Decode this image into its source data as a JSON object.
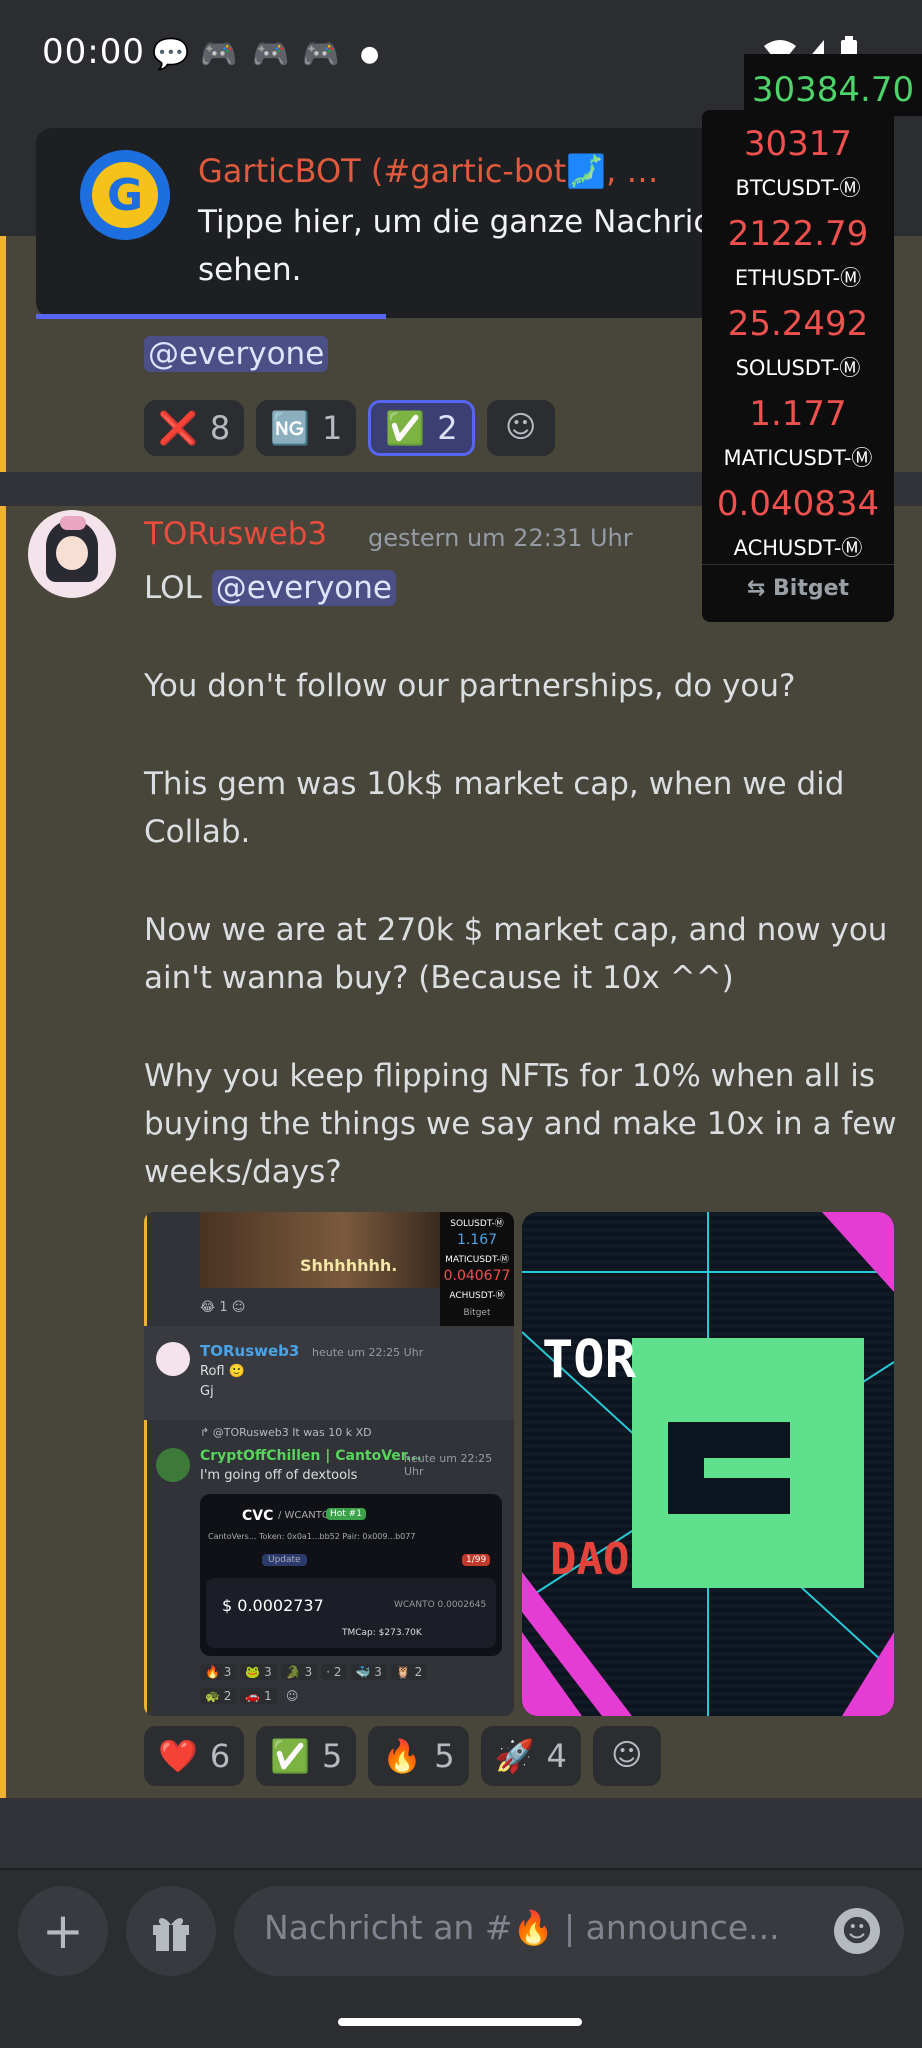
{
  "status_bar": {
    "time": "00:00"
  },
  "notification": {
    "title": "GarticBOT (#gartic-bot🗾, …",
    "text_line1": "Tippe hier, um die ganze Nachricht zu",
    "text_line2": "sehen."
  },
  "previous_message": {
    "mention": "@everyone",
    "reactions": [
      {
        "emoji": "❌",
        "count": "8"
      },
      {
        "emoji": "🆖",
        "count": "1"
      },
      {
        "emoji": "✅",
        "count": "2",
        "active": true
      }
    ]
  },
  "ticker": {
    "top_value": "30384.70",
    "items": [
      {
        "price": "30317",
        "symbol": "BTCUSDT-Ⓜ"
      },
      {
        "price": "2122.79",
        "symbol": "ETHUSDT-Ⓜ"
      },
      {
        "price": "25.2492",
        "symbol": "SOLUSDT-Ⓜ"
      },
      {
        "price": "1.177",
        "symbol": "MATICUSDT-Ⓜ"
      },
      {
        "price": "0.040834",
        "symbol": "ACHUSDT-Ⓜ"
      }
    ],
    "brand": "Bitget"
  },
  "message": {
    "author": "TORusweb3",
    "timestamp": "gestern um 22:31 Uhr",
    "line_lol": "LOL",
    "mention": "@everyone",
    "paragraphs": {
      "p1": "You don't follow our partnerships, do you?",
      "p2a": "This gem was 10k$ market cap, when we did",
      "p2b": "Collab.",
      "p3a": "Now we are at 270k $ market cap, and now you",
      "p3b": "ain't wanna buy? (Because it 10x ^^)",
      "p4a": "Why you keep flipping NFTs for 10% when all is",
      "p4b": "buying the things we say and make 10x in a few",
      "p4c": "weeks/days?"
    },
    "reactions": [
      {
        "emoji": "❤️",
        "count": "6"
      },
      {
        "emoji": "✅",
        "count": "5"
      },
      {
        "emoji": "🔥",
        "count": "5"
      },
      {
        "emoji": "🚀",
        "count": "4"
      }
    ]
  },
  "screenshot_image": {
    "gif_caption": "Shhhhhhh.",
    "mini_ticker": {
      "sym1": "SOLUSDT-Ⓜ",
      "p1": "1.167",
      "sym2": "MATICUSDT-Ⓜ",
      "p2": "0.040677",
      "sym3": "ACHUSDT-Ⓜ",
      "brand": "Bitget"
    },
    "mini_react_count": "1",
    "author1": "TORusweb3",
    "time1": "heute um 22:25 Uhr",
    "line1": "Rofl 🙂",
    "line2": "Gj",
    "reply_ref": "@TORusweb3 It was 10 k XD",
    "author2": "CryptOffChillen | CantoVer...",
    "time2": "heute um 22:25 Uhr",
    "line3": "I'm going off of dextools",
    "card": {
      "pair": "CVC",
      "quote": "/ WCANTO",
      "hot": "Hot #1",
      "sub": "CantoVers...  Token: 0x0a1...bb52  Pair: 0x009...b077",
      "update": "Update",
      "badge": "1/99",
      "price": "$ 0.0002737",
      "wcanto": "WCANTO 0.0002645",
      "tmcap": "TMCap: $273.70K"
    },
    "mini_reactions": [
      "3",
      "3",
      "3",
      "2",
      "3",
      "2",
      "2",
      "1"
    ]
  },
  "tor_image": {
    "title": "TOR",
    "subtitle": "DAO"
  },
  "composer": {
    "placeholder": "Nachricht an #🔥 | announce..."
  }
}
